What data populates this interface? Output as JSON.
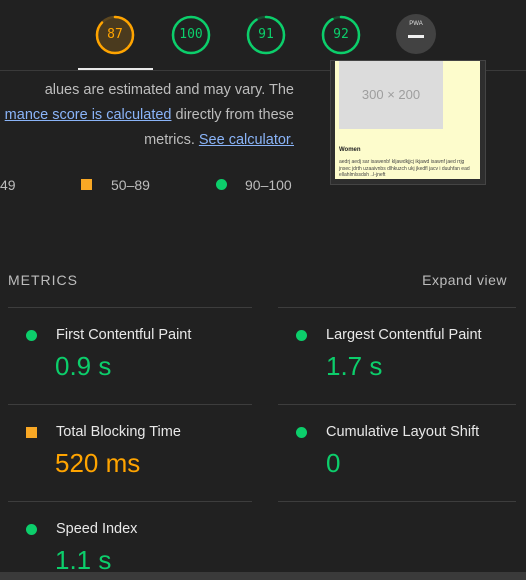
{
  "colors": {
    "pass": "#0cce6b",
    "average": "#ffa400",
    "link": "#8ab4f8"
  },
  "scores": [
    {
      "category": "performance",
      "value": 87,
      "label": "87",
      "color": "#ffa400"
    },
    {
      "category": "accessibility",
      "value": 100,
      "label": "100",
      "color": "#0cce6b"
    },
    {
      "category": "best-practices",
      "value": 91,
      "label": "91",
      "color": "#0cce6b"
    },
    {
      "category": "seo",
      "value": 92,
      "label": "92",
      "color": "#0cce6b"
    }
  ],
  "pwa": {
    "badge": "PWA",
    "icon": "dash-icon"
  },
  "description": {
    "line1": "alues are estimated and may vary. The",
    "link1": "mance score is calculated",
    "line2_rest": " directly from these",
    "line3_prefix": "metrics. ",
    "link2": "See calculator."
  },
  "legend": {
    "range_low": "49",
    "range_mid": "50–89",
    "range_high": "90–100"
  },
  "thumbnail": {
    "placeholder": "300 × 200",
    "heading": "Women",
    "body": "aedrj aedj sar isawenb! kljawdkjjcj ikjawd isawnf jaed rrjg jnsec jdrth uzaaivnbs dlhkuzch ukj jkedfl jacv i duuhfan ead ellahlmlssdsh ..l-jneft"
  },
  "metrics": {
    "title": "METRICS",
    "expand": "Expand view",
    "items": [
      {
        "label": "First Contentful Paint",
        "value": "0.9 s",
        "status": "pass"
      },
      {
        "label": "Largest Contentful Paint",
        "value": "1.7 s",
        "status": "pass"
      },
      {
        "label": "Total Blocking Time",
        "value": "520 ms",
        "status": "average"
      },
      {
        "label": "Cumulative Layout Shift",
        "value": "0",
        "status": "pass"
      },
      {
        "label": "Speed Index",
        "value": "1.1 s",
        "status": "pass"
      }
    ]
  }
}
